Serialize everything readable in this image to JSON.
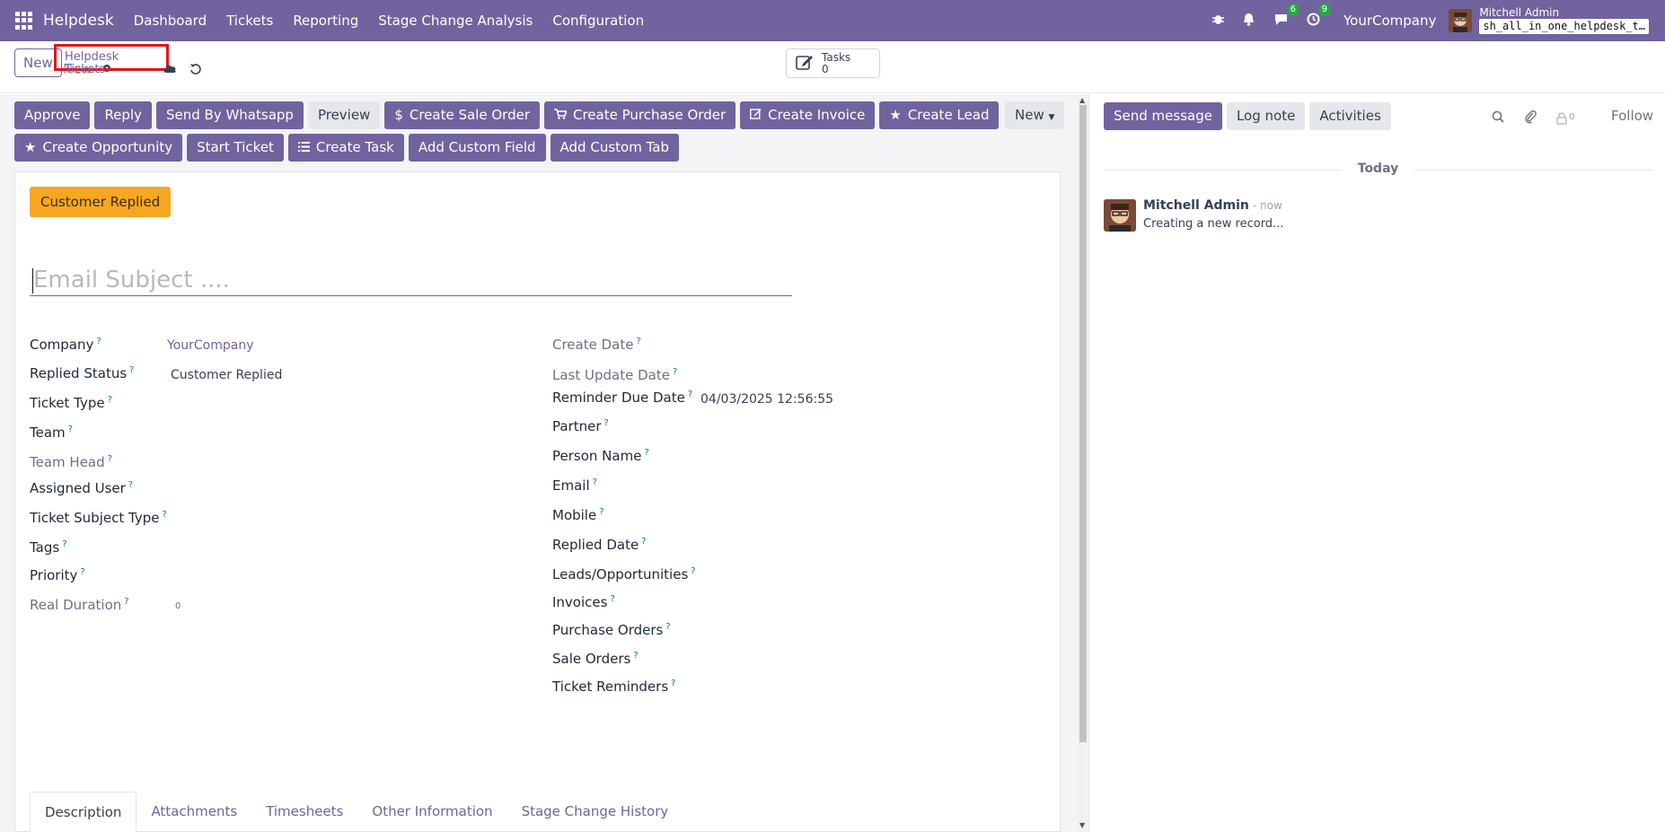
{
  "topnav": {
    "brand": "Helpdesk",
    "menu": [
      "Dashboard",
      "Tickets",
      "Reporting",
      "Stage Change Analysis",
      "Configuration"
    ],
    "messages_badge": "6",
    "activities_badge": "9",
    "company": "YourCompany",
    "user_name": "Mitchell Admin",
    "db_name": "sh_all_in_one_helpdesk_t…"
  },
  "control": {
    "new_label": "New",
    "breadcrumb": "Helpdesk Tickets",
    "record_name": "New",
    "tasks_label": "Tasks",
    "tasks_count": "0"
  },
  "actions": {
    "row1": [
      {
        "label": "Approve",
        "icon": ""
      },
      {
        "label": "Reply",
        "icon": ""
      },
      {
        "label": "Send By Whatsapp",
        "icon": ""
      },
      {
        "label": "Preview",
        "icon": "",
        "light": true
      },
      {
        "label": "Create Sale Order",
        "icon": "$"
      },
      {
        "label": "Create Purchase Order",
        "icon": "cart"
      },
      {
        "label": "Create Invoice",
        "icon": "edit"
      },
      {
        "label": "Create Lead",
        "icon": "star"
      }
    ],
    "row2": [
      {
        "label": "Create Opportunity",
        "icon": "star"
      },
      {
        "label": "Start Ticket",
        "icon": ""
      },
      {
        "label": "Create Task",
        "icon": "list"
      },
      {
        "label": "Add Custom Field",
        "icon": ""
      },
      {
        "label": "Add Custom Tab",
        "icon": ""
      }
    ],
    "new_dropdown": "New"
  },
  "form": {
    "status_button": "Customer Replied",
    "subject_placeholder": "Email Subject ....",
    "left_fields": [
      {
        "label": "Company",
        "value": "YourCompany"
      },
      {
        "label": "Replied Status",
        "value": "Customer Replied"
      },
      {
        "label": "Ticket Type",
        "value": ""
      },
      {
        "label": "Team",
        "value": ""
      },
      {
        "label": "Team Head",
        "value": ""
      },
      {
        "label": "Assigned User",
        "value": ""
      },
      {
        "label": "Ticket Subject Type",
        "value": ""
      },
      {
        "label": "Tags",
        "value": ""
      },
      {
        "label": "Priority",
        "value": ""
      },
      {
        "label": "Real Duration",
        "value": "0"
      }
    ],
    "right_fields": [
      {
        "label": "Create Date",
        "value": ""
      },
      {
        "label": "Last Update Date",
        "value": ""
      },
      {
        "label": "Reminder Due Date",
        "value": "04/03/2025 12:56:55"
      },
      {
        "label": "Partner",
        "value": ""
      },
      {
        "label": "Person Name",
        "value": ""
      },
      {
        "label": "Email",
        "value": ""
      },
      {
        "label": "Mobile",
        "value": ""
      },
      {
        "label": "Replied Date",
        "value": ""
      },
      {
        "label": "Leads/Opportunities",
        "value": ""
      },
      {
        "label": "Invoices",
        "value": ""
      },
      {
        "label": "Purchase Orders",
        "value": ""
      },
      {
        "label": "Sale Orders",
        "value": ""
      },
      {
        "label": "Ticket Reminders",
        "value": ""
      }
    ],
    "tabs": [
      "Description",
      "Attachments",
      "Timesheets",
      "Other Information",
      "Stage Change History"
    ],
    "help_mark": "?"
  },
  "chatter": {
    "send_message": "Send message",
    "log_note": "Log note",
    "activities": "Activities",
    "followers_count": "0",
    "follow": "Follow",
    "today": "Today",
    "message_author": "Mitchell Admin",
    "message_time": "- now",
    "message_body": "Creating a new record..."
  }
}
